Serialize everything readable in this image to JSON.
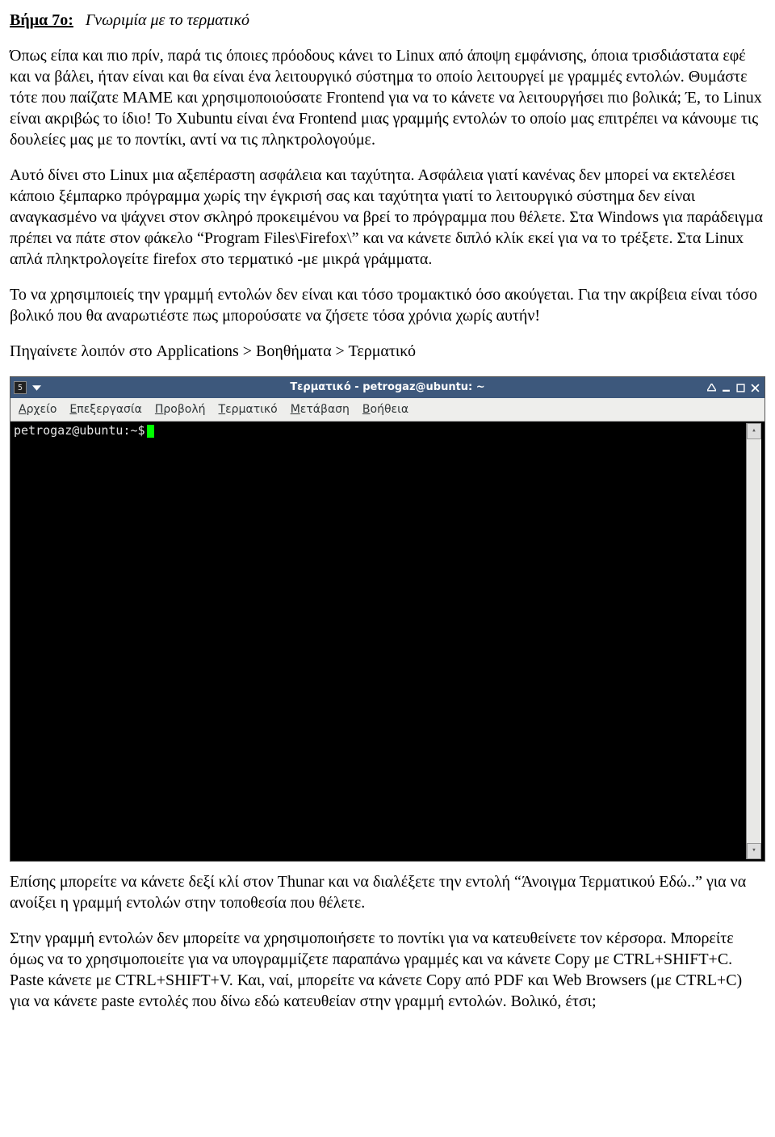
{
  "heading": {
    "step_label": "Βήμα 7ο:",
    "step_title": "Γνωριμία με το τερματικό"
  },
  "paragraphs": {
    "p1": "Όπως είπα και πιο πρίν, παρά τις όποιες πρόοδους κάνει το Linux από άποψη εμφάνισης, όποια τρισδιάστατα εφέ και να βάλει, ήταν είναι και θα είναι ένα λειτουργικό σύστημα το οποίο λειτουργεί με γραμμές εντολών. Θυμάστε τότε που παίζατε MAME και χρησιμοποιούσατε Frontend για να το κάνετε να λειτουργήσει πιο βολικά; Έ, το Linux είναι ακριβώς το ίδιο! Το Xubuntu είναι ένα Frontend μιας γραμμής εντολών το οποίο μας επιτρέπει να κάνουμε τις δουλείες μας με το ποντίκι, αντί να τις πληκτρολογούμε.",
    "p2": "Αυτό δίνει στο Linux μια αξεπέραστη ασφάλεια και ταχύτητα. Ασφάλεια γιατί κανένας δεν μπορεί να εκτελέσει κάποιο ξέμπαρκο πρόγραμμα χωρίς την έγκρισή σας και ταχύτητα γιατί το λειτουργικό σύστημα δεν είναι αναγκασμένο να ψάχνει στον σκληρό προκειμένου να βρεί το πρόγραμμα που θέλετε. Στα Windows για παράδειγμα πρέπει να πάτε στον φάκελο “Program Files\\Firefox\\” και να κάνετε διπλό κλίκ εκεί για να το τρέξετε. Στα Linux απλά πληκτρολογείτε firefox στο τερματικό -με μικρά γράμματα.",
    "p3": "Το να χρησιμποιείς την γραμμή εντολών δεν είναι και τόσο τρομακτικό όσο ακούγεται. Για την ακρίβεια είναι τόσο βολικό που θα αναρωτιέστε πως μπορούσατε να ζήσετε τόσα χρόνια χωρίς αυτήν!",
    "p4": "Πηγαίνετε λοιπόν στο Applications > Βοηθήματα > Τερματικό",
    "p5": "Επίσης μπορείτε να κάνετε δεξί κλί στον Thunar και να διαλέξετε την εντολή “Άνοιγμα Τερματικού Εδώ..” για να ανοίξει η γραμμή εντολών στην τοποθεσία που θέλετε.",
    "p6": "Στην γραμμή εντολών δεν μπορείτε να χρησιμοποιήσετε το ποντίκι για να κατευθείνετε τον κέρσορα. Μπορείτε όμως να το χρησιμοποιείτε για να υπογραμμίζετε παραπάνω γραμμές και να κάνετε Copy με CTRL+SHIFT+C. Paste κάνετε με CTRL+SHIFT+V. Και, ναί, μπορείτε να κάνετε Copy από PDF και Web Browsers (με CTRL+C) για να κάνετε paste εντολές που δίνω εδώ κατευθείαν στην γραμμή εντολών. Βολικό, έτσι;"
  },
  "terminal": {
    "title": "Τερματικό - petrogaz@ubuntu: ~",
    "app_icon_label": "5",
    "menubar": {
      "file": {
        "accel": "Α",
        "rest": "ρχείο"
      },
      "edit": {
        "accel": "Ε",
        "rest": "πεξεργασία"
      },
      "view": {
        "accel": "Π",
        "rest": "ροβολή"
      },
      "term": {
        "accel": "Τ",
        "rest": "ερματικό"
      },
      "go": {
        "accel": "Μ",
        "rest": "ετάβαση"
      },
      "help": {
        "accel": "Β",
        "rest": "οήθεια"
      }
    },
    "prompt": "petrogaz@ubuntu:~$",
    "scroll_up": "▴",
    "scroll_down": "▾"
  }
}
